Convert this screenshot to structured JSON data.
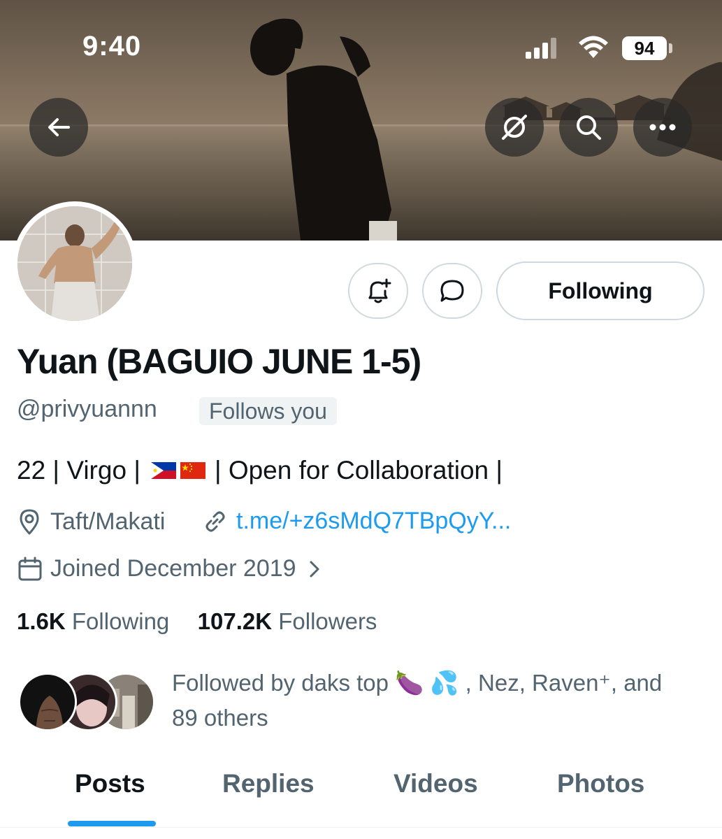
{
  "status_bar": {
    "time": "9:40",
    "battery": "94"
  },
  "profile": {
    "name": "Yuan (BAGUIO JUNE 1-5)",
    "handle": "@privyuannn",
    "follows_you_badge": "Follows you",
    "bio_text_before_flags": "22 | Virgo |",
    "bio_text_after_flags": "| Open for Collaboration |",
    "location": "Taft/Makati",
    "website": "t.me/+z6sMdQ7TBpQyY...",
    "joined": "Joined December 2019",
    "following_count": "1.6K",
    "following_label": "Following",
    "followers_count": "107.2K",
    "followers_label": "Followers",
    "followed_by_line1": "Followed by daks top 🍆 💦 , Nez, Raven⁺, and",
    "followed_by_line2": "89 others"
  },
  "actions": {
    "following_button": "Following"
  },
  "tabs": [
    {
      "label": "Posts"
    },
    {
      "label": "Replies"
    },
    {
      "label": "Videos"
    },
    {
      "label": "Photos"
    }
  ],
  "icons": [
    "back-arrow-icon",
    "grok-icon",
    "search-icon",
    "more-icon",
    "notification-add-icon",
    "message-icon",
    "location-icon",
    "link-icon",
    "calendar-icon",
    "chevron-right-icon"
  ],
  "colors": {
    "accent": "#1d9bf0",
    "text": "#0f1419",
    "secondary": "#536471"
  }
}
